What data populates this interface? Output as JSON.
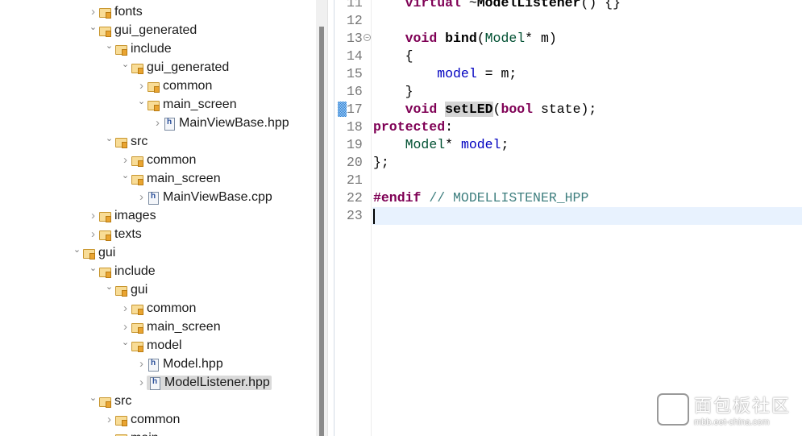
{
  "tree": [
    {
      "label": "fonts",
      "depth": 1,
      "type": "folder",
      "expanded": false
    },
    {
      "label": "gui_generated",
      "depth": 1,
      "type": "folder",
      "expanded": true
    },
    {
      "label": "include",
      "depth": 2,
      "type": "folder",
      "expanded": true
    },
    {
      "label": "gui_generated",
      "depth": 3,
      "type": "folder",
      "expanded": true
    },
    {
      "label": "common",
      "depth": 4,
      "type": "folder",
      "expanded": false
    },
    {
      "label": "main_screen",
      "depth": 4,
      "type": "folder",
      "expanded": true
    },
    {
      "label": "MainViewBase.hpp",
      "depth": 5,
      "type": "file",
      "expanded": false
    },
    {
      "label": "src",
      "depth": 2,
      "type": "folder",
      "expanded": true
    },
    {
      "label": "common",
      "depth": 3,
      "type": "folder",
      "expanded": false
    },
    {
      "label": "main_screen",
      "depth": 3,
      "type": "folder",
      "expanded": true
    },
    {
      "label": "MainViewBase.cpp",
      "depth": 4,
      "type": "file",
      "expanded": false
    },
    {
      "label": "images",
      "depth": 1,
      "type": "folder",
      "expanded": false
    },
    {
      "label": "texts",
      "depth": 1,
      "type": "folder",
      "expanded": false
    },
    {
      "label": "gui",
      "depth": 0,
      "type": "folder",
      "expanded": true
    },
    {
      "label": "include",
      "depth": 1,
      "type": "folder",
      "expanded": true
    },
    {
      "label": "gui",
      "depth": 2,
      "type": "folder",
      "expanded": true
    },
    {
      "label": "common",
      "depth": 3,
      "type": "folder",
      "expanded": false
    },
    {
      "label": "main_screen",
      "depth": 3,
      "type": "folder",
      "expanded": false
    },
    {
      "label": "model",
      "depth": 3,
      "type": "folder",
      "expanded": true
    },
    {
      "label": "Model.hpp",
      "depth": 4,
      "type": "file",
      "expanded": false
    },
    {
      "label": "ModelListener.hpp",
      "depth": 4,
      "type": "file",
      "expanded": false,
      "selected": true
    },
    {
      "label": "src",
      "depth": 1,
      "type": "folder",
      "expanded": true
    },
    {
      "label": "common",
      "depth": 2,
      "type": "folder",
      "expanded": false
    },
    {
      "label": "main",
      "depth": 2,
      "type": "folder",
      "expanded": false
    }
  ],
  "editor": {
    "lines": [
      {
        "n": "11",
        "tokens": [
          [
            "    ",
            ""
          ],
          [
            "virtual",
            "kw"
          ],
          [
            " ~",
            ""
          ],
          [
            "ModelListener",
            "fn"
          ],
          [
            "() {}",
            ""
          ]
        ]
      },
      {
        "n": "12",
        "tokens": []
      },
      {
        "n": "13",
        "tokens": [
          [
            "    ",
            ""
          ],
          [
            "void",
            "kw"
          ],
          [
            " ",
            ""
          ],
          [
            "bind",
            "fn"
          ],
          [
            "(",
            ""
          ],
          [
            "Model",
            "ty"
          ],
          [
            "* m)",
            ""
          ]
        ]
      },
      {
        "n": "14",
        "tokens": [
          [
            "    {",
            ""
          ]
        ]
      },
      {
        "n": "15",
        "tokens": [
          [
            "        ",
            ""
          ],
          [
            "model",
            "fld"
          ],
          [
            " = m;",
            ""
          ]
        ]
      },
      {
        "n": "16",
        "tokens": [
          [
            "    }",
            ""
          ]
        ]
      },
      {
        "n": "17",
        "tokens": [
          [
            "    ",
            ""
          ],
          [
            "void",
            "kw"
          ],
          [
            " ",
            ""
          ],
          [
            "setLED",
            "fn hl"
          ],
          [
            "(",
            ""
          ],
          [
            "bool",
            "kw"
          ],
          [
            " state);",
            ""
          ]
        ]
      },
      {
        "n": "18",
        "tokens": [
          [
            "protected",
            "kw"
          ],
          [
            ":",
            ""
          ]
        ]
      },
      {
        "n": "19",
        "tokens": [
          [
            "    ",
            ""
          ],
          [
            "Model",
            "ty"
          ],
          [
            "* ",
            ""
          ],
          [
            "model",
            "fld"
          ],
          [
            ";",
            ""
          ]
        ]
      },
      {
        "n": "20",
        "tokens": [
          [
            "};",
            ""
          ]
        ]
      },
      {
        "n": "21",
        "tokens": []
      },
      {
        "n": "22",
        "tokens": [
          [
            "#endif",
            "kw"
          ],
          [
            " // MODELLISTENER_HPP",
            "cm"
          ]
        ]
      },
      {
        "n": "23",
        "tokens": []
      }
    ]
  },
  "watermark": {
    "title": "面包板社区",
    "subtitle": "mbb.eet-china.com"
  }
}
